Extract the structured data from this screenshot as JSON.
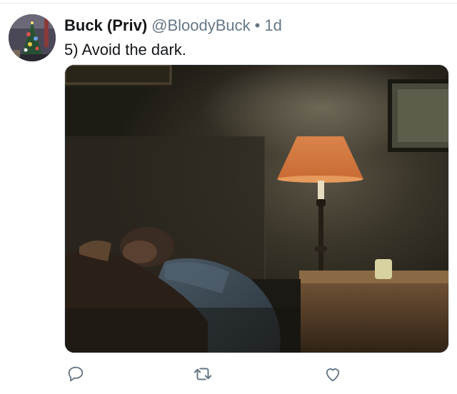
{
  "tweet": {
    "display_name": "Buck (Priv)",
    "handle": "@BloodyBuck",
    "separator": "•",
    "time": "1d",
    "text": "5) Avoid the dark."
  },
  "icons": {
    "reply": "reply-icon",
    "retweet": "retweet-icon",
    "like": "like-icon"
  },
  "colors": {
    "name": "#14171a",
    "secondary": "#657786",
    "action_icon": "#657786",
    "divider": "#e6ecf0"
  }
}
